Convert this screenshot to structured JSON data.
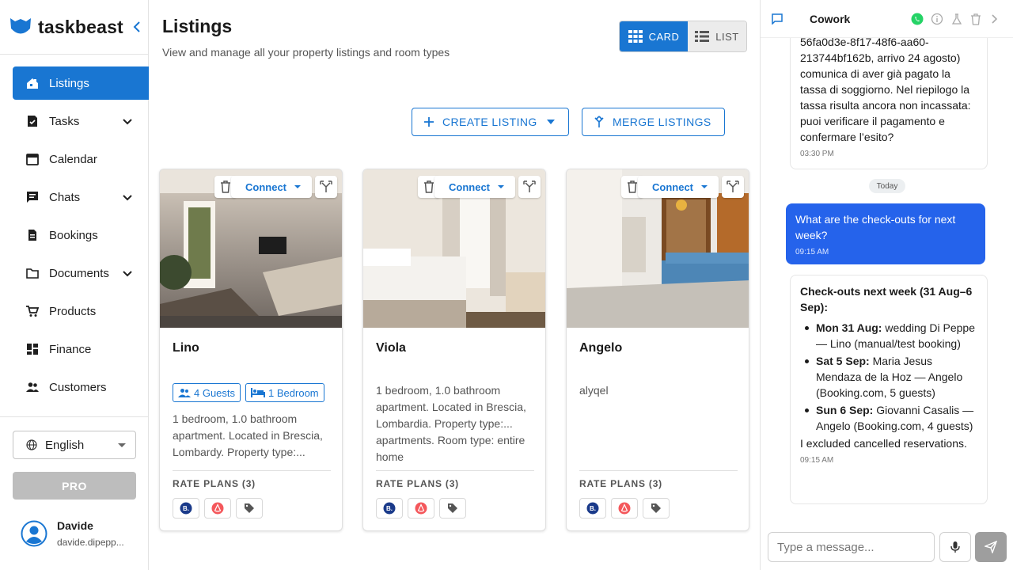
{
  "brand": {
    "name": "taskbeast",
    "accent": "#1976d2"
  },
  "sidebar": {
    "items": [
      {
        "label": "Listings",
        "icon": "listings-icon",
        "active": true,
        "expandable": false
      },
      {
        "label": "Tasks",
        "icon": "tasks-icon",
        "active": false,
        "expandable": true
      },
      {
        "label": "Calendar",
        "icon": "calendar-icon",
        "active": false,
        "expandable": false
      },
      {
        "label": "Chats",
        "icon": "chat-icon",
        "active": false,
        "expandable": true
      },
      {
        "label": "Bookings",
        "icon": "bookings-icon",
        "active": false,
        "expandable": false
      },
      {
        "label": "Documents",
        "icon": "folder-icon",
        "active": false,
        "expandable": true
      },
      {
        "label": "Products",
        "icon": "cart-icon",
        "active": false,
        "expandable": false
      },
      {
        "label": "Finance",
        "icon": "dashboard-icon",
        "active": false,
        "expandable": false
      },
      {
        "label": "Customers",
        "icon": "people-icon",
        "active": false,
        "expandable": false
      }
    ],
    "language": "English",
    "pro_label": "PRO",
    "user": {
      "name": "Davide",
      "email": "davide.dipepp..."
    }
  },
  "main": {
    "title": "Listings",
    "subtitle": "View and manage all your property listings and room types",
    "view_toggle": {
      "card": "CARD",
      "list": "LIST",
      "selected": "card"
    },
    "create_label": "CREATE LISTING",
    "merge_label": "MERGE LISTINGS",
    "connect_label": "Connect",
    "rate_plans_label": "RATE PLANS (3)",
    "listings": [
      {
        "name": "Lino",
        "guests": "4 Guests",
        "bedrooms": "1 Bedroom",
        "description": "1 bedroom, 1.0 bathroom apartment. Located in Brescia, Lombardy. Property type:..."
      },
      {
        "name": "Viola",
        "description": "1 bedroom, 1.0 bathroom apartment. Located in Brescia, Lombardia. Property type:... apartments. Room type: entire  home"
      },
      {
        "name": "Angelo",
        "description": "alyqel"
      }
    ]
  },
  "cowork": {
    "title": "Cowork",
    "prev_message": {
      "text": "56fa0d3e-8f17-48f6-aa60-213744bf162b, arrivo 24 agosto) comunica di aver già pagato la tassa di soggiorno. Nel riepilogo la tassa risulta ancora non incassata: puoi verificare il pagamento e confermare l’esito?",
      "time": "03:30 PM"
    },
    "divider": "Today",
    "user_message": {
      "text": "What are the check-outs for next week?",
      "time": "09:15 AM"
    },
    "reply": {
      "heading": "Check-outs next week (31 Aug–6 Sep):",
      "items": [
        {
          "date": "Mon 31 Aug:",
          "detail": " wedding Di Peppe — Lino (manual/test booking)"
        },
        {
          "date": "Sat 5 Sep:",
          "detail": " Maria Jesus Mendaza de la Hoz — Angelo (Booking.com, 5 guests)"
        },
        {
          "date": "Sun 6 Sep:",
          "detail": " Giovanni Casalis — Angelo (Booking.com, 4 guests)"
        }
      ],
      "footer": "I excluded cancelled reservations.",
      "time": "09:15 AM"
    },
    "input_placeholder": "Type a message..."
  }
}
